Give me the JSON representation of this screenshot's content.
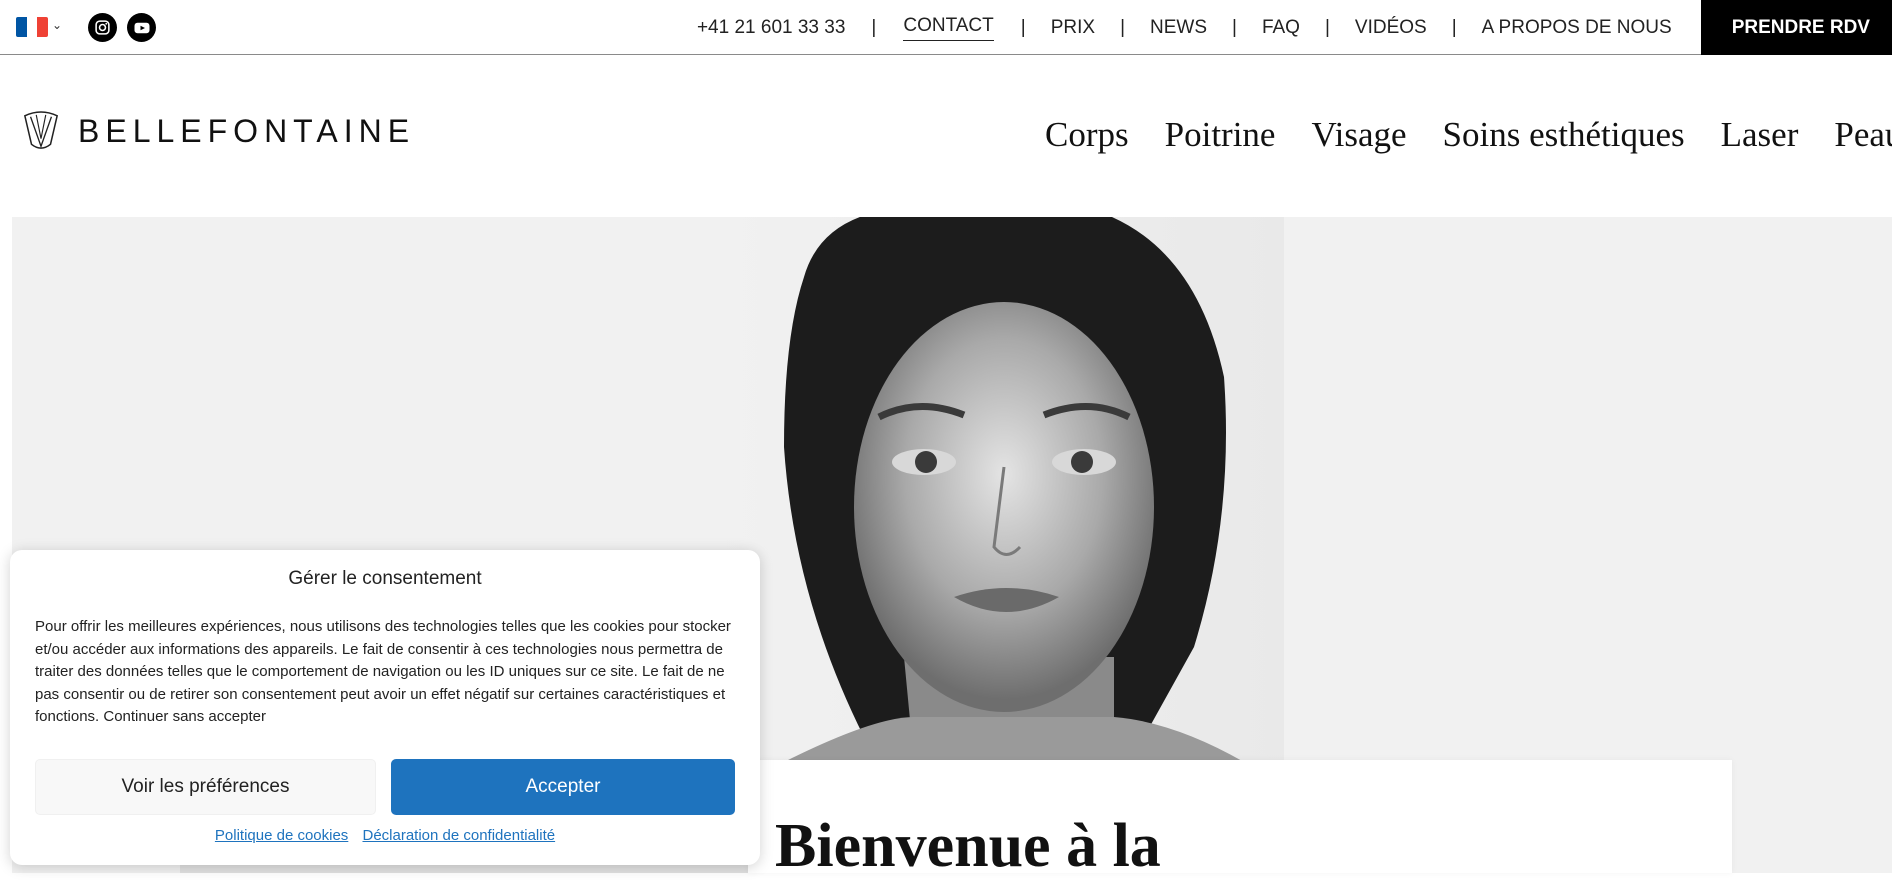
{
  "topbar": {
    "language": "French",
    "flag_colors": [
      "#0055A4",
      "#FFFFFF",
      "#EF4135"
    ],
    "social": [
      {
        "name": "instagram-icon"
      },
      {
        "name": "youtube-icon"
      }
    ],
    "phone": "+41 21 601 33 33",
    "separator": "|",
    "links": [
      "CONTACT",
      "PRIX",
      "NEWS",
      "FAQ",
      "VIDÉOS",
      "A PROPOS DE NOUS"
    ],
    "cta": "PRENDRE RDV"
  },
  "brand": {
    "name": "BELLEFONTAINE"
  },
  "main_nav": [
    "Corps",
    "Poitrine",
    "Visage",
    "Soins esthétiques",
    "Laser",
    "Peau"
  ],
  "hero": {
    "title": "Bienvenue à la"
  },
  "consent": {
    "title": "Gérer le consentement",
    "body": "Pour offrir les meilleures expériences, nous utilisons des technologies telles que les cookies pour stocker et/ou accéder aux informations des appareils. Le fait de consentir à ces technologies nous permettra de traiter des données telles que le comportement de navigation ou les ID uniques sur ce site. Le fait de ne pas consentir ou de retirer son consentement peut avoir un effet négatif sur certaines caractéristiques et fonctions. Continuer sans accepter",
    "preferences_button": "Voir les préférences",
    "accept_button": "Accepter",
    "cookie_policy_link": "Politique de cookies",
    "privacy_link": "Déclaration de confidentialité",
    "accent_color": "#1e73be"
  }
}
